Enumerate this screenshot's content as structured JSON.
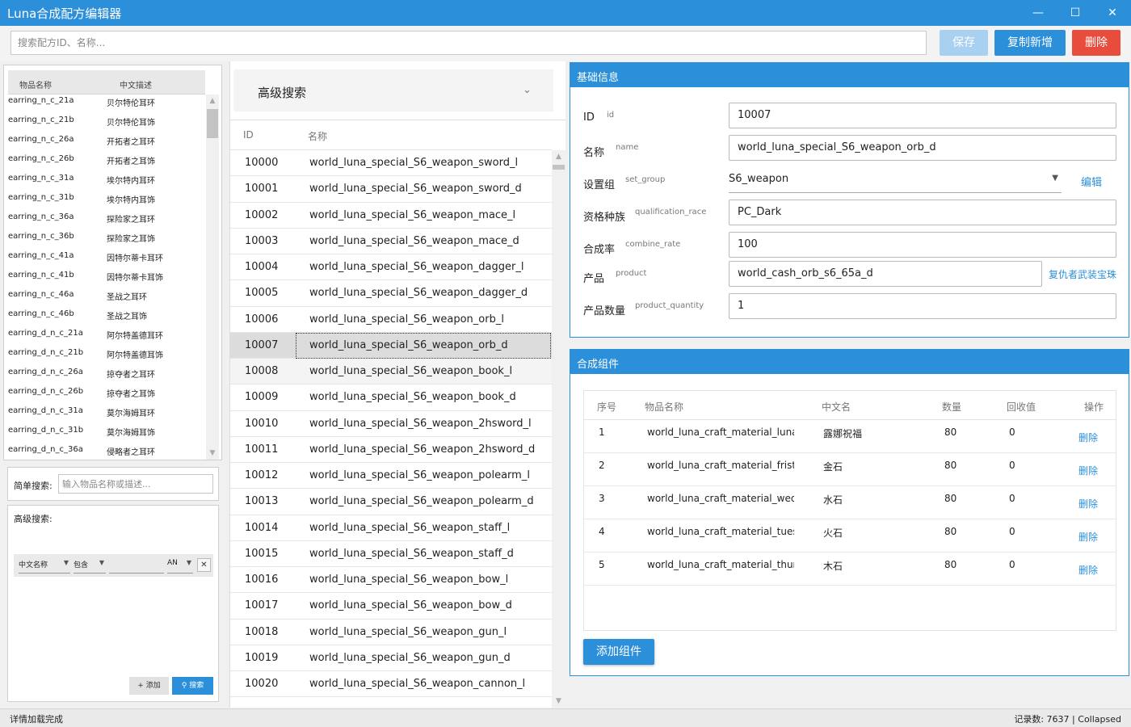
{
  "window": {
    "title": "Luna合成配方编辑器"
  },
  "toolbar": {
    "search_placeholder": "搜索配方ID、名称...",
    "save_label": "保存",
    "copy_new_label": "复制新增",
    "delete_label": "删除",
    "colors": {
      "save": "#a8d0f0",
      "copy": "#2b8fd9",
      "delete": "#e84c3d"
    }
  },
  "item_list": {
    "headers": [
      "物品名称",
      "中文描述"
    ],
    "rows": [
      [
        "earring_n_c_21a",
        "贝尔特伦耳环"
      ],
      [
        "earring_n_c_21b",
        "贝尔特伦耳饰"
      ],
      [
        "earring_n_c_26a",
        "开拓者之耳环"
      ],
      [
        "earring_n_c_26b",
        "开拓者之耳饰"
      ],
      [
        "earring_n_c_31a",
        "埃尔特内耳环"
      ],
      [
        "earring_n_c_31b",
        "埃尔特内耳饰"
      ],
      [
        "earring_n_c_36a",
        "探险家之耳环"
      ],
      [
        "earring_n_c_36b",
        "探险家之耳饰"
      ],
      [
        "earring_n_c_41a",
        "因特尔蒂卡耳环"
      ],
      [
        "earring_n_c_41b",
        "因特尔蒂卡耳饰"
      ],
      [
        "earring_n_c_46a",
        "圣战之耳环"
      ],
      [
        "earring_n_c_46b",
        "圣战之耳饰"
      ],
      [
        "earring_d_n_c_21a",
        "阿尔特盖德耳环"
      ],
      [
        "earring_d_n_c_21b",
        "阿尔特盖德耳饰"
      ],
      [
        "earring_d_n_c_26a",
        "掠夺者之耳环"
      ],
      [
        "earring_d_n_c_26b",
        "掠夺者之耳饰"
      ],
      [
        "earring_d_n_c_31a",
        "莫尔海姆耳环"
      ],
      [
        "earring_d_n_c_31b",
        "莫尔海姆耳饰"
      ],
      [
        "earring_d_n_c_36a",
        "侵略者之耳环"
      ]
    ]
  },
  "simple_search": {
    "label": "简单搜索:",
    "placeholder": "输入物品名称或描述..."
  },
  "advanced_filter": {
    "label": "高级搜索:",
    "field": "中文名称",
    "operator": "包含",
    "value": "",
    "logic": "AN",
    "add_label": "+ 添加",
    "search_label": "搜索"
  },
  "recipe_list": {
    "advanced_search_title": "高级搜索",
    "headers": [
      "ID",
      "名称"
    ],
    "selected_id": "10007",
    "rows": [
      [
        "10000",
        "world_luna_special_S6_weapon_sword_l"
      ],
      [
        "10001",
        "world_luna_special_S6_weapon_sword_d"
      ],
      [
        "10002",
        "world_luna_special_S6_weapon_mace_l"
      ],
      [
        "10003",
        "world_luna_special_S6_weapon_mace_d"
      ],
      [
        "10004",
        "world_luna_special_S6_weapon_dagger_l"
      ],
      [
        "10005",
        "world_luna_special_S6_weapon_dagger_d"
      ],
      [
        "10006",
        "world_luna_special_S6_weapon_orb_l"
      ],
      [
        "10007",
        "world_luna_special_S6_weapon_orb_d"
      ],
      [
        "10008",
        "world_luna_special_S6_weapon_book_l"
      ],
      [
        "10009",
        "world_luna_special_S6_weapon_book_d"
      ],
      [
        "10010",
        "world_luna_special_S6_weapon_2hsword_l"
      ],
      [
        "10011",
        "world_luna_special_S6_weapon_2hsword_d"
      ],
      [
        "10012",
        "world_luna_special_S6_weapon_polearm_l"
      ],
      [
        "10013",
        "world_luna_special_S6_weapon_polearm_d"
      ],
      [
        "10014",
        "world_luna_special_S6_weapon_staff_l"
      ],
      [
        "10015",
        "world_luna_special_S6_weapon_staff_d"
      ],
      [
        "10016",
        "world_luna_special_S6_weapon_bow_l"
      ],
      [
        "10017",
        "world_luna_special_S6_weapon_bow_d"
      ],
      [
        "10018",
        "world_luna_special_S6_weapon_gun_l"
      ],
      [
        "10019",
        "world_luna_special_S6_weapon_gun_d"
      ],
      [
        "10020",
        "world_luna_special_S6_weapon_cannon_l"
      ]
    ]
  },
  "basic_info": {
    "title": "基础信息",
    "fields": {
      "id": {
        "label": "ID",
        "key": "id",
        "value": "10007"
      },
      "name": {
        "label": "名称",
        "key": "name",
        "value": "world_luna_special_S6_weapon_orb_d"
      },
      "set_group": {
        "label": "设置组",
        "key": "set_group",
        "value": "S6_weapon",
        "action": "编辑"
      },
      "qualification_race": {
        "label": "资格种族",
        "key": "qualification_race",
        "value": "PC_Dark"
      },
      "combine_rate": {
        "label": "合成率",
        "key": "combine_rate",
        "value": "100"
      },
      "product": {
        "label": "产品",
        "key": "product",
        "value": "world_cash_orb_s6_65a_d",
        "link": "复仇者武装宝珠"
      },
      "product_quantity": {
        "label": "产品数量",
        "key": "product_quantity",
        "value": "1"
      }
    }
  },
  "components": {
    "title": "合成组件",
    "headers": [
      "序号",
      "物品名称",
      "中文名",
      "数量",
      "回收值",
      "操作"
    ],
    "delete_label": "删除",
    "rows": [
      [
        "1",
        "world_luna_craft_material_lunab",
        "露娜祝福",
        "80",
        "0"
      ],
      [
        "2",
        "world_luna_craft_material_fristo",
        "金石",
        "80",
        "0"
      ],
      [
        "3",
        "world_luna_craft_material_weds",
        "水石",
        "80",
        "0"
      ],
      [
        "4",
        "world_luna_craft_material_tuesd",
        "火石",
        "80",
        "0"
      ],
      [
        "5",
        "world_luna_craft_material_thurs",
        "木石",
        "80",
        "0"
      ]
    ],
    "add_label": "添加组件"
  },
  "status": {
    "left": "详情加载完成",
    "record_label": "记录数:",
    "record_count": "7637",
    "separator": "|",
    "mode": "Collapsed"
  }
}
